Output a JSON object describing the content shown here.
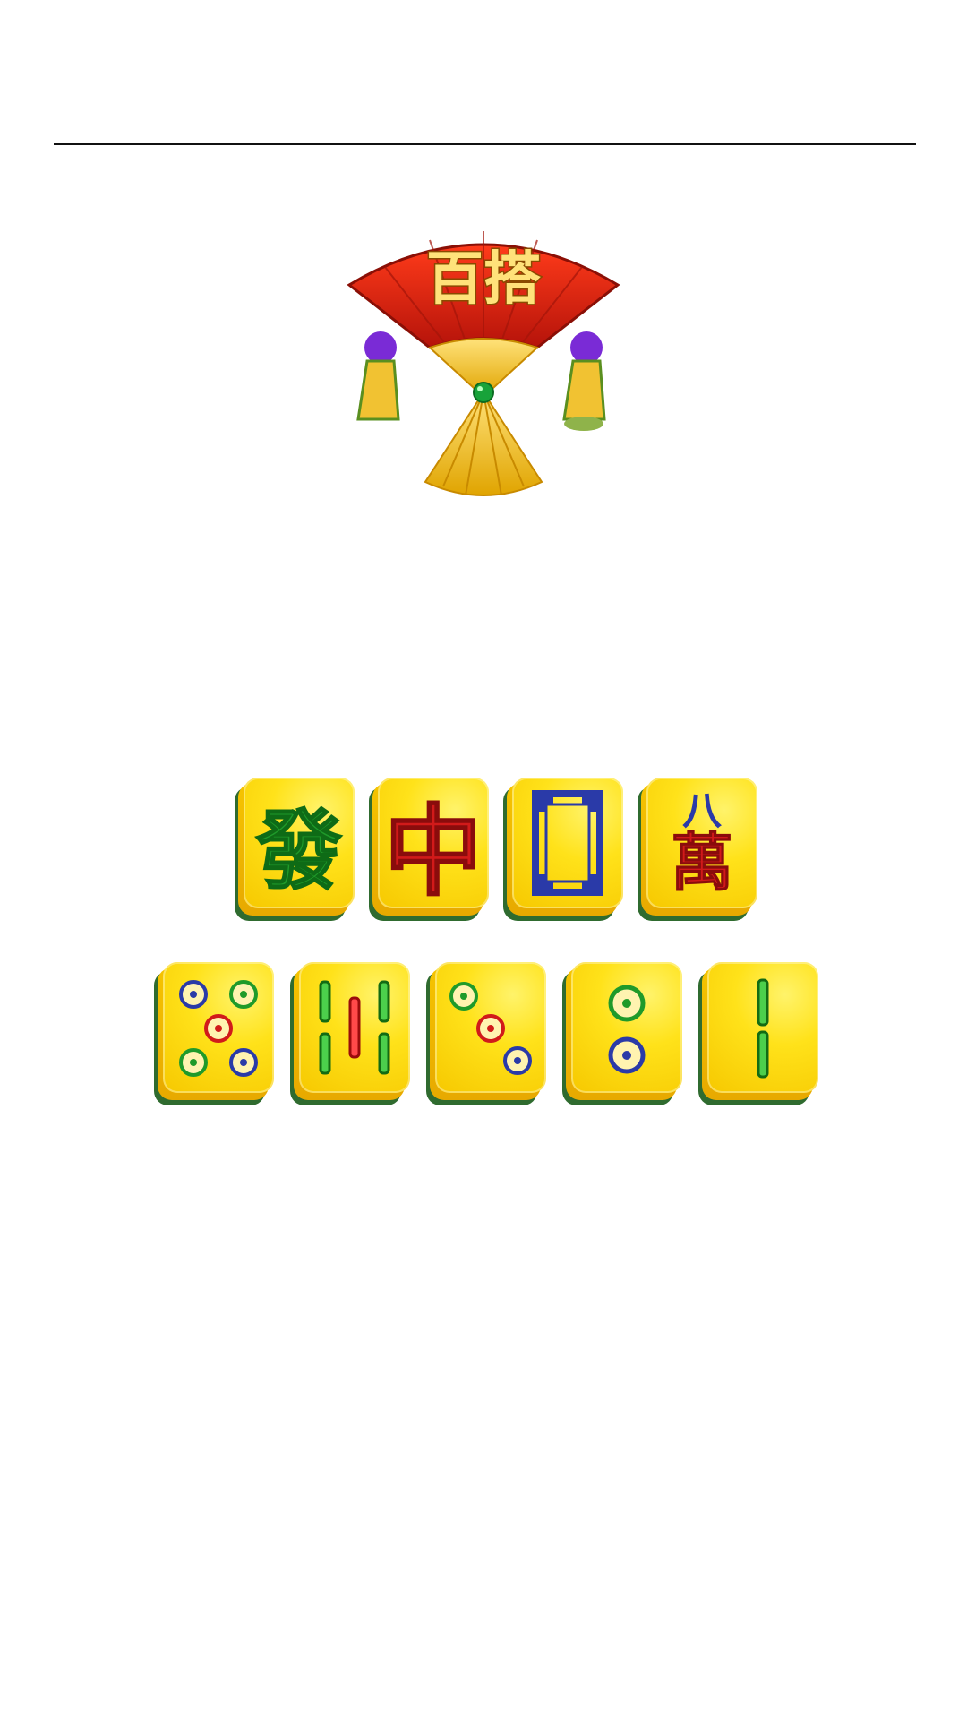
{
  "logo": {
    "text": "百搭",
    "colors": {
      "fan_red": "#d8200c",
      "fan_gold": "#f1c232",
      "tassel_purple": "#7a2bd6",
      "gem_green": "#18a33a"
    }
  },
  "tiles": {
    "top_row": [
      {
        "name": "green-dragon",
        "char": "發",
        "color": "#1f9a2a"
      },
      {
        "name": "red-dragon",
        "char": "中",
        "color": "#d11a1a"
      },
      {
        "name": "white-dragon",
        "char": "",
        "color": "#2a3aa8"
      },
      {
        "name": "eight-wan",
        "top": "八",
        "char": "萬",
        "top_color": "#2a3aa8",
        "color": "#d11a1a"
      }
    ],
    "bottom_row": [
      {
        "name": "five-dots"
      },
      {
        "name": "six-bamboo"
      },
      {
        "name": "three-dots"
      },
      {
        "name": "two-dots"
      },
      {
        "name": "two-bamboo"
      }
    ]
  },
  "colors": {
    "tile_face": "#ffe21a",
    "tile_shadow": "#2f6b2f",
    "divider": "#111111"
  }
}
